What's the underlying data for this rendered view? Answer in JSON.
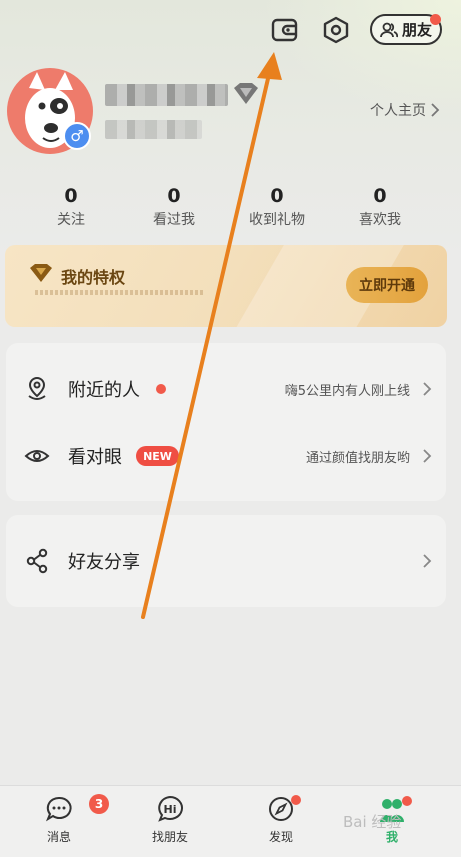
{
  "header": {
    "friends_label": "朋友"
  },
  "profile": {
    "profile_link": "个人主页"
  },
  "stats": [
    {
      "value": "0",
      "label": "关注"
    },
    {
      "value": "0",
      "label": "看过我"
    },
    {
      "value": "0",
      "label": "收到礼物"
    },
    {
      "value": "0",
      "label": "喜欢我"
    }
  ],
  "privilege": {
    "title": "我的特权",
    "button": "立即开通"
  },
  "menu": {
    "nearby": {
      "title": "附近的人",
      "desc": "嗨5公里内有人刚上线"
    },
    "match": {
      "title": "看对眼",
      "badge": "NEW",
      "desc": "通过颜值找朋友哟"
    },
    "share": {
      "title": "好友分享"
    }
  },
  "tabbar": {
    "messages": {
      "label": "消息",
      "badge": "3"
    },
    "find_friends": {
      "label": "找朋友"
    },
    "discover": {
      "label": "发现"
    },
    "me": {
      "label": "我"
    }
  },
  "watermark": "Bai 经验",
  "colors": {
    "accent_green": "#2fb06a",
    "red_dot": "#f15a4a",
    "gold_button": "#e3a23c",
    "arrow_orange": "#e8801e"
  }
}
